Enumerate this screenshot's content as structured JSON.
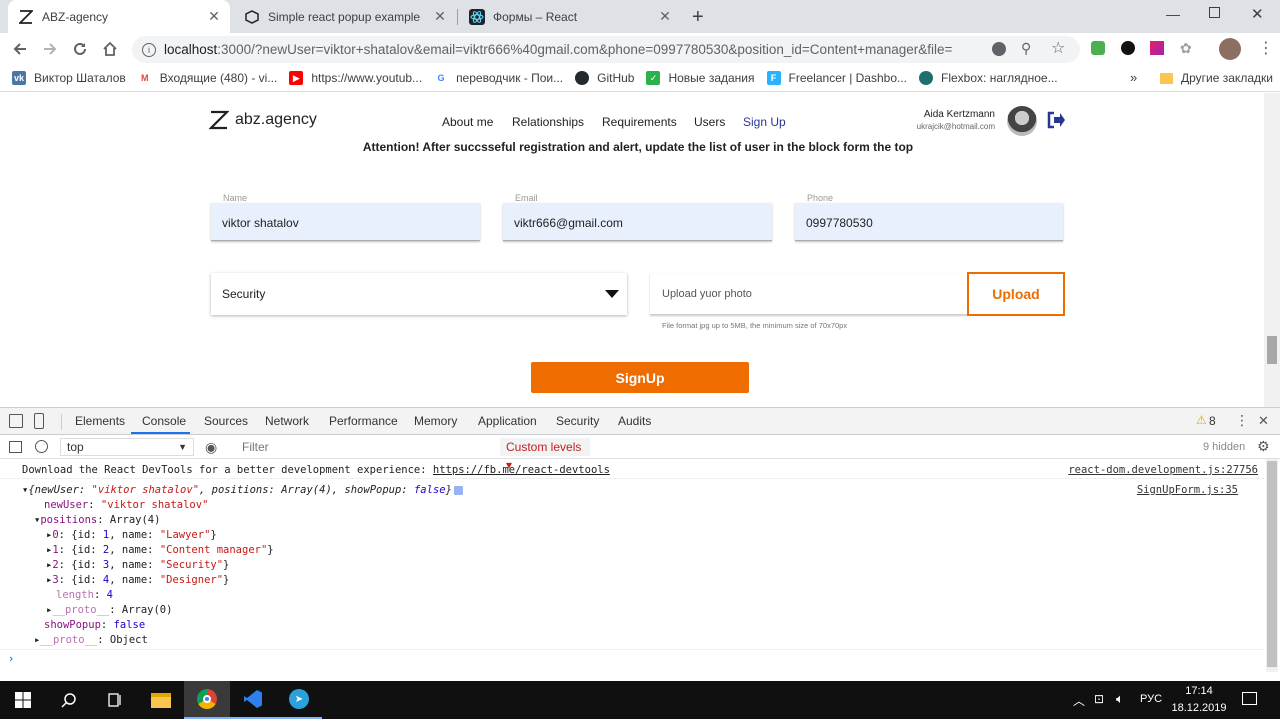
{
  "tabs": [
    {
      "title": "ABZ-agency",
      "active": true
    },
    {
      "title": "Simple react popup example",
      "active": false
    },
    {
      "title": "Формы – React",
      "active": false
    }
  ],
  "address": {
    "host": "localhost",
    "path": ":3000/?newUser=viktor+shatalov&email=viktr666%40gmail.com&phone=0997780530&position_id=Content+manager&file="
  },
  "bookmarks": [
    {
      "label": "Виктор Шаталов",
      "color": "#4a76a8",
      "glyph": "vk"
    },
    {
      "label": "Входящие (480) - vi...",
      "color": "#ea4335",
      "glyph": "M"
    },
    {
      "label": "https://www.youtub...",
      "color": "#ff0000",
      "glyph": "▶"
    },
    {
      "label": "переводчик - Пои...",
      "color": "#4285f4",
      "glyph": "G"
    },
    {
      "label": "GitHub",
      "color": "#24292e",
      "glyph": "●"
    },
    {
      "label": "Новые задания",
      "color": "#2bb24c",
      "glyph": "✓"
    },
    {
      "label": "Freelancer | Dashbo...",
      "color": "#29b2fe",
      "glyph": "F"
    },
    {
      "label": "Flexbox: наглядное...",
      "color": "#1f6f6f",
      "glyph": "f"
    }
  ],
  "bookmarks_more": "»",
  "other_bookmarks": "Другие закладки",
  "site": {
    "logo": "abz.agency",
    "nav": [
      "About me",
      "Relationships",
      "Requirements",
      "Users",
      "Sign Up"
    ],
    "user_name": "Aida Kertzmann",
    "user_email": "ukrajcik@hotmail.com",
    "attention": "Attention! After succsseful registration and alert, update the list of user in the block form the top",
    "name_label": "Name",
    "name_value": "viktor shatalov",
    "email_label": "Email",
    "email_value": "viktr666@gmail.com",
    "phone_label": "Phone",
    "phone_value": "0997780530",
    "position_value": "Security",
    "upload_placeholder": "Upload yuor photo",
    "upload_button": "Upload",
    "upload_hint": "File format jpg up to 5MB, the minimum size of 70x70px",
    "signup_button": "SignUp",
    "accent": "#ef6c00"
  },
  "devtools": {
    "tabs": [
      "Elements",
      "Console",
      "Sources",
      "Network",
      "Performance",
      "Memory",
      "Application",
      "Security",
      "Audits"
    ],
    "warnings": "8",
    "context": "top",
    "filter_placeholder": "Filter",
    "levels": "Custom levels ▾",
    "hidden": "9 hidden",
    "msg1": "Download the React DevTools for a better development experience: ",
    "msg1_link": "https://fb.me/react-devtools",
    "msg1_src": "react-dom.development.js:27756",
    "obj_src": "SignUpForm.js:35"
  },
  "taskbar": {
    "lang": "РУС",
    "time": "17:14",
    "date": "18.12.2019"
  }
}
